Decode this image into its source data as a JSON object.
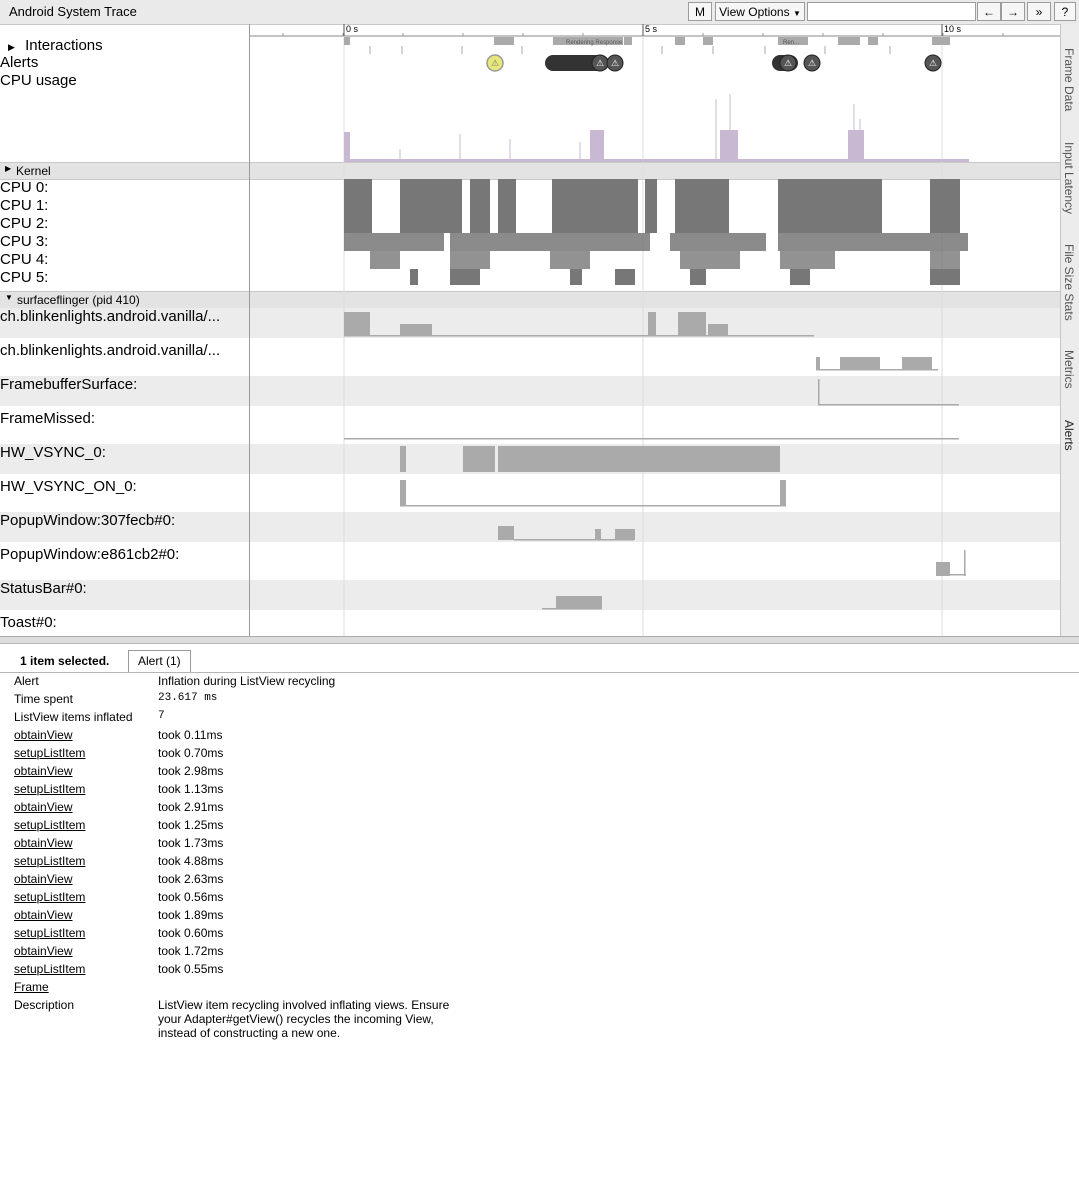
{
  "app_title": "Android System Trace",
  "toolbar": {
    "m_label": "M",
    "view_options_label": "View Options",
    "search_placeholder": "",
    "prev_label": "←",
    "next_label": "→",
    "more_label": "»",
    "help_label": "?"
  },
  "timeline": {
    "ticks": [
      "0 s",
      "5 s",
      "10 s"
    ],
    "slice_labels": [
      "Rendering Response",
      "Ren..."
    ]
  },
  "tracks": {
    "interactions": "Interactions",
    "alerts": "Alerts",
    "cpu_usage": "CPU usage",
    "kernel": "Kernel",
    "cpus": [
      "CPU 0:",
      "CPU 1:",
      "CPU 2:",
      "CPU 3:",
      "CPU 4:",
      "CPU 5:"
    ],
    "process": "surfaceflinger (pid 410)",
    "counters": [
      "ch.blinkenlights.android.vanilla/...",
      "ch.blinkenlights.android.vanilla/...",
      "FramebufferSurface:",
      "FrameMissed:",
      "HW_VSYNC_0:",
      "HW_VSYNC_ON_0:",
      "PopupWindow:307fecb#0:",
      "PopupWindow:e861cb2#0:",
      "StatusBar#0:",
      "Toast#0:"
    ]
  },
  "side_tabs": [
    "Frame Data",
    "Input Latency",
    "File Size Stats",
    "Metrics",
    "Alerts"
  ],
  "analysis": {
    "selection_count": "1 item selected.",
    "tab_label": "Alert (1)",
    "rows": [
      {
        "key": "Alert",
        "value": "Inflation during ListView recycling",
        "link": false,
        "mono": false
      },
      {
        "key": "Time spent",
        "value": "23.617 ms",
        "link": false,
        "mono": true
      },
      {
        "key": "ListView items inflated",
        "value": "7",
        "link": false,
        "mono": true
      },
      {
        "key": "obtainView",
        "value": "took 0.11ms",
        "link": true,
        "mono": false
      },
      {
        "key": "setupListItem",
        "value": "took 0.70ms",
        "link": true,
        "mono": false
      },
      {
        "key": "obtainView",
        "value": "took 2.98ms",
        "link": true,
        "mono": false
      },
      {
        "key": "setupListItem",
        "value": "took 1.13ms",
        "link": true,
        "mono": false
      },
      {
        "key": "obtainView",
        "value": "took 2.91ms",
        "link": true,
        "mono": false
      },
      {
        "key": "setupListItem",
        "value": "took 1.25ms",
        "link": true,
        "mono": false
      },
      {
        "key": "obtainView",
        "value": "took 1.73ms",
        "link": true,
        "mono": false
      },
      {
        "key": "setupListItem",
        "value": "took 4.88ms",
        "link": true,
        "mono": false
      },
      {
        "key": "obtainView",
        "value": "took 2.63ms",
        "link": true,
        "mono": false
      },
      {
        "key": "setupListItem",
        "value": "took 0.56ms",
        "link": true,
        "mono": false
      },
      {
        "key": "obtainView",
        "value": "took 1.89ms",
        "link": true,
        "mono": false
      },
      {
        "key": "setupListItem",
        "value": "took 0.60ms",
        "link": true,
        "mono": false
      },
      {
        "key": "obtainView",
        "value": "took 1.72ms",
        "link": true,
        "mono": false
      },
      {
        "key": "setupListItem",
        "value": "took 0.55ms",
        "link": true,
        "mono": false
      },
      {
        "key": "Frame",
        "value": "",
        "link": true,
        "mono": false
      }
    ],
    "description_key": "Description",
    "description": "ListView item recycling involved inflating views. Ensure your Adapter#getView() recycles the incoming View, instead of constructing a new one."
  }
}
